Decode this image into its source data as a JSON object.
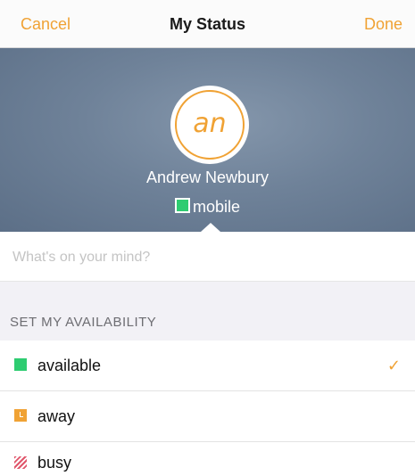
{
  "nav": {
    "cancel_label": "Cancel",
    "title": "My Status",
    "done_label": "Done"
  },
  "profile": {
    "initials": "an",
    "name": "Andrew Newbury",
    "status_label": "mobile",
    "status_color": "#2ecc71"
  },
  "mind": {
    "placeholder": "What's on your mind?",
    "value": ""
  },
  "availability": {
    "section_title": "SET MY AVAILABILITY",
    "options": [
      {
        "label": "available",
        "icon": "available-square-icon",
        "color": "#2ecc71",
        "selected": true
      },
      {
        "label": "away",
        "icon": "away-clock-icon",
        "color": "#f0a234",
        "selected": false
      },
      {
        "label": "busy",
        "icon": "busy-striped-icon",
        "color": "#e0566b",
        "selected": false
      }
    ],
    "check_glyph": "✓"
  },
  "colors": {
    "accent": "#f0a234",
    "header_bg": "#6f8299"
  }
}
